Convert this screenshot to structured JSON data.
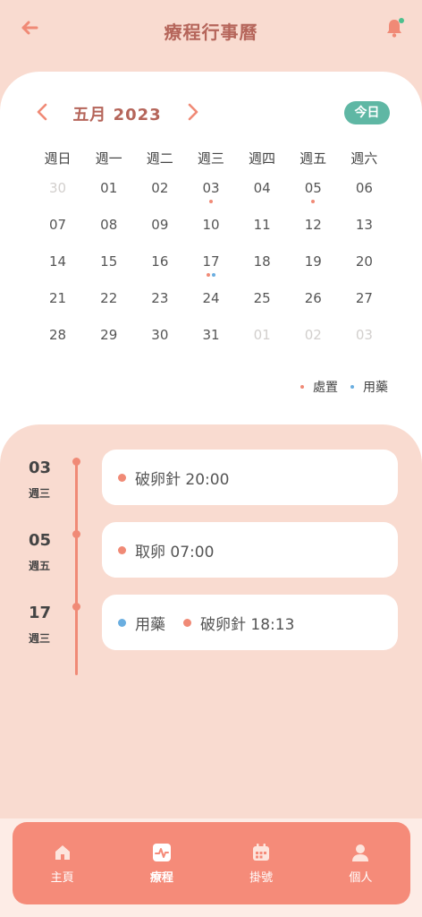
{
  "header": {
    "title": "療程行事曆"
  },
  "calendar": {
    "month": "五月 2023",
    "today": "今日",
    "weekdays": [
      "週日",
      "週一",
      "週二",
      "週三",
      "週四",
      "週五",
      "週六"
    ],
    "days": [
      {
        "d": "30",
        "muted": true
      },
      {
        "d": "01"
      },
      {
        "d": "02"
      },
      {
        "d": "03",
        "dots": [
          "treatment"
        ]
      },
      {
        "d": "04"
      },
      {
        "d": "05",
        "dots": [
          "treatment"
        ]
      },
      {
        "d": "06"
      },
      {
        "d": "07"
      },
      {
        "d": "08"
      },
      {
        "d": "09"
      },
      {
        "d": "10"
      },
      {
        "d": "11"
      },
      {
        "d": "12"
      },
      {
        "d": "13"
      },
      {
        "d": "14"
      },
      {
        "d": "15"
      },
      {
        "d": "16"
      },
      {
        "d": "17",
        "dots": [
          "treatment",
          "medication"
        ]
      },
      {
        "d": "18"
      },
      {
        "d": "19"
      },
      {
        "d": "20"
      },
      {
        "d": "21"
      },
      {
        "d": "22"
      },
      {
        "d": "23"
      },
      {
        "d": "24"
      },
      {
        "d": "25"
      },
      {
        "d": "26"
      },
      {
        "d": "27"
      },
      {
        "d": "28"
      },
      {
        "d": "29"
      },
      {
        "d": "30"
      },
      {
        "d": "31"
      },
      {
        "d": "01",
        "muted": true
      },
      {
        "d": "02",
        "muted": true
      },
      {
        "d": "03",
        "muted": true
      }
    ],
    "legend": {
      "treatment": "處置",
      "medication": "用藥"
    }
  },
  "colors": {
    "treatment": "#f08a76",
    "medication": "#6aaee0",
    "accent": "#f58b79",
    "today": "#5fb7a4",
    "title": "#b5655a"
  },
  "events": [
    {
      "date": "03",
      "weekday": "週三",
      "items": [
        {
          "type": "treatment",
          "text": "破卵針 20:00"
        }
      ]
    },
    {
      "date": "05",
      "weekday": "週五",
      "items": [
        {
          "type": "treatment",
          "text": "取卵 07:00"
        }
      ]
    },
    {
      "date": "17",
      "weekday": "週三",
      "items": [
        {
          "type": "medication",
          "text": "用藥"
        },
        {
          "type": "treatment",
          "text": "破卵針 18:13"
        }
      ]
    }
  ],
  "nav": [
    {
      "label": "主頁",
      "icon": "home-icon"
    },
    {
      "label": "療程",
      "icon": "chart-icon",
      "active": true
    },
    {
      "label": "掛號",
      "icon": "calendar-icon"
    },
    {
      "label": "個人",
      "icon": "user-icon"
    }
  ]
}
